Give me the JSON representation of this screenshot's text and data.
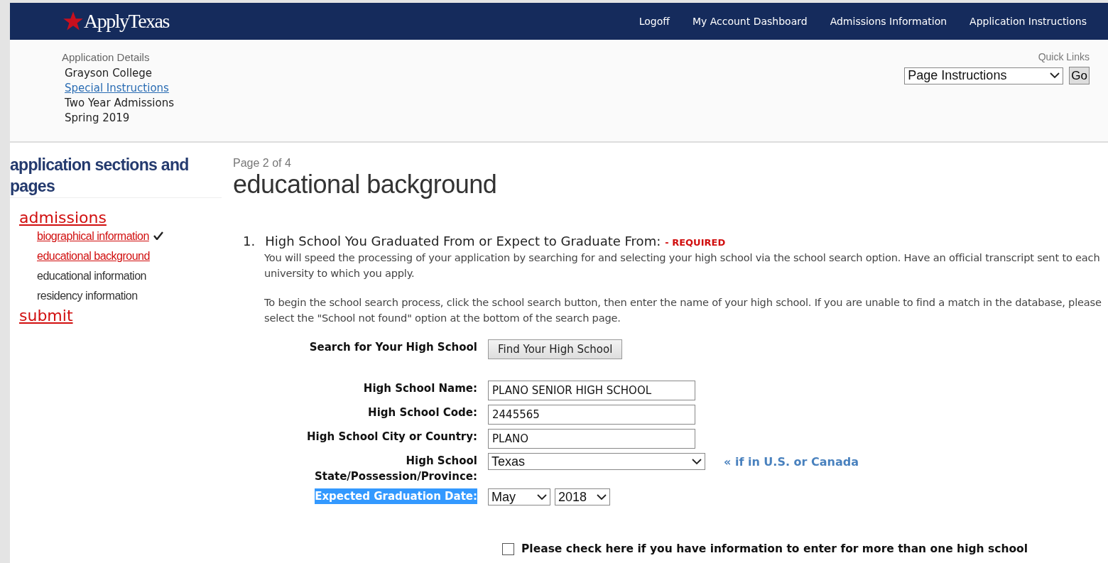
{
  "header": {
    "logo": "ApplyTexas",
    "nav": [
      "Logoff",
      "My Account Dashboard",
      "Admissions Information",
      "Application Instructions"
    ]
  },
  "details": {
    "title": "Application Details",
    "lines": [
      {
        "text": "Grayson College",
        "link": false
      },
      {
        "text": "Special Instructions",
        "link": true
      },
      {
        "text": "Two Year Admissions",
        "link": false
      },
      {
        "text": "Spring 2019",
        "link": false
      }
    ],
    "quick_links": {
      "label": "Quick Links",
      "value": "Page Instructions",
      "button": "Go"
    }
  },
  "sidebar": {
    "title": "application sections and pages",
    "sections": [
      {
        "label": "admissions",
        "children": [
          {
            "label": "biographical information",
            "link": true,
            "done": true
          },
          {
            "label": "educational background",
            "link": true,
            "done": false
          },
          {
            "label": "educational information",
            "link": false,
            "done": false
          },
          {
            "label": "residency information",
            "link": false,
            "done": false
          }
        ]
      },
      {
        "label": "submit"
      }
    ]
  },
  "page": {
    "counter": "Page 2 of 4",
    "title": "educational background",
    "question": {
      "number": "1.",
      "text": "High School You Graduated From or Expect to Graduate From:",
      "required": "- REQUIRED",
      "paragraphs": [
        "You will speed the processing of your application by searching for and selecting your high school via the school search option. Have an official transcript sent to each university to which you apply.",
        "To begin the school search process, click the school search button, then enter the name of your high school. If you are unable to find a match in the database, please select the \"School not found\" option at the bottom of the search page."
      ],
      "fields": [
        {
          "kind": "button",
          "label": "Search for Your High School",
          "value": "Find Your High School",
          "highlighted": false
        },
        {
          "kind": "text",
          "label": "High School Name:",
          "value": "PLANO SENIOR HIGH SCHOOL",
          "highlighted": false
        },
        {
          "kind": "text",
          "label": "High School Code:",
          "value": "2445565",
          "highlighted": false
        },
        {
          "kind": "text",
          "label": "High School City or Country:",
          "value": "PLANO",
          "highlighted": false
        },
        {
          "kind": "select",
          "label": "High School State/Possession/Province:",
          "value": "Texas",
          "note": "« if in U.S. or Canada",
          "highlighted": false
        },
        {
          "kind": "date",
          "label": "Expected Graduation Date:",
          "month": "May",
          "year": "2018",
          "highlighted": true
        }
      ],
      "checkbox": {
        "label": "Please check here if you have information to enter for more than one high school",
        "checked": false
      }
    }
  }
}
